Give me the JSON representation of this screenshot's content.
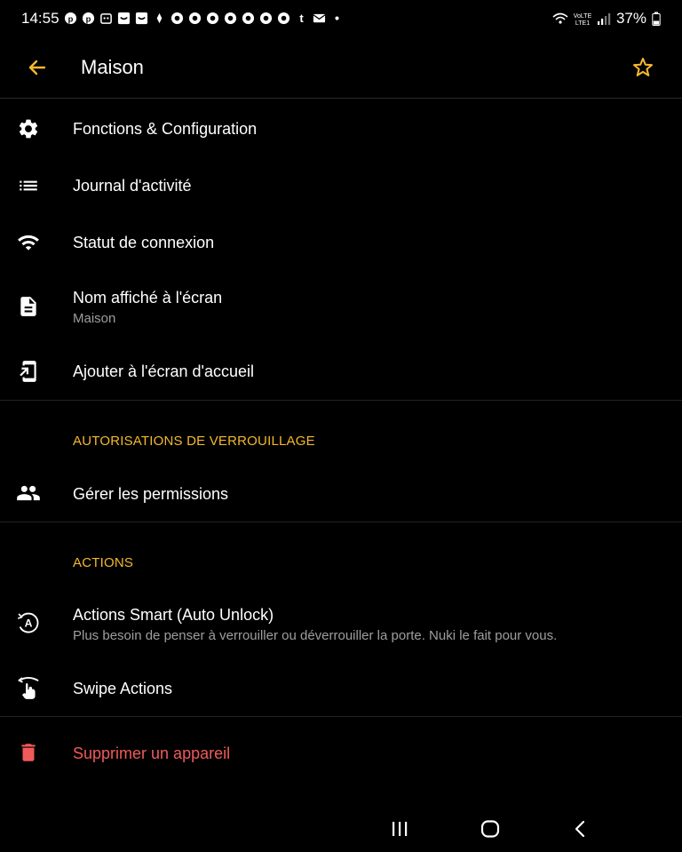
{
  "status_bar": {
    "time": "14:55",
    "battery": "37%",
    "notification_icons": [
      "pinterest-icon",
      "pinterest-icon",
      "app-icon",
      "app-icon",
      "app-icon",
      "app-icon",
      "chrome-icon",
      "chrome-icon",
      "chrome-icon",
      "chrome-icon",
      "chrome-icon",
      "chrome-icon",
      "chrome-icon",
      "tumblr-icon",
      "mail-icon",
      "dot-icon"
    ]
  },
  "app_bar": {
    "title": "Maison"
  },
  "menu": {
    "functions": {
      "title": "Fonctions & Configuration"
    },
    "activity_log": {
      "title": "Journal d'activité"
    },
    "connection_status": {
      "title": "Statut de connexion"
    },
    "display_name": {
      "title": "Nom affiché à l'écran",
      "subtitle": "Maison"
    },
    "add_home": {
      "title": "Ajouter à l'écran d'accueil"
    }
  },
  "sections": {
    "lock_permissions": {
      "header": "AUTORISATIONS DE VERROUILLAGE",
      "manage": {
        "title": "Gérer les permissions"
      }
    },
    "actions": {
      "header": "ACTIONS",
      "smart": {
        "title": "Actions Smart (Auto Unlock)",
        "subtitle": "Plus besoin de penser à verrouiller ou déverrouiller la porte. Nuki le fait pour vous."
      },
      "swipe": {
        "title": "Swipe Actions"
      }
    }
  },
  "delete": {
    "title": "Supprimer un appareil"
  },
  "colors": {
    "accent": "#f5b82e",
    "danger": "#f15a5a",
    "background": "#000000",
    "secondary_text": "#9e9e9e"
  }
}
